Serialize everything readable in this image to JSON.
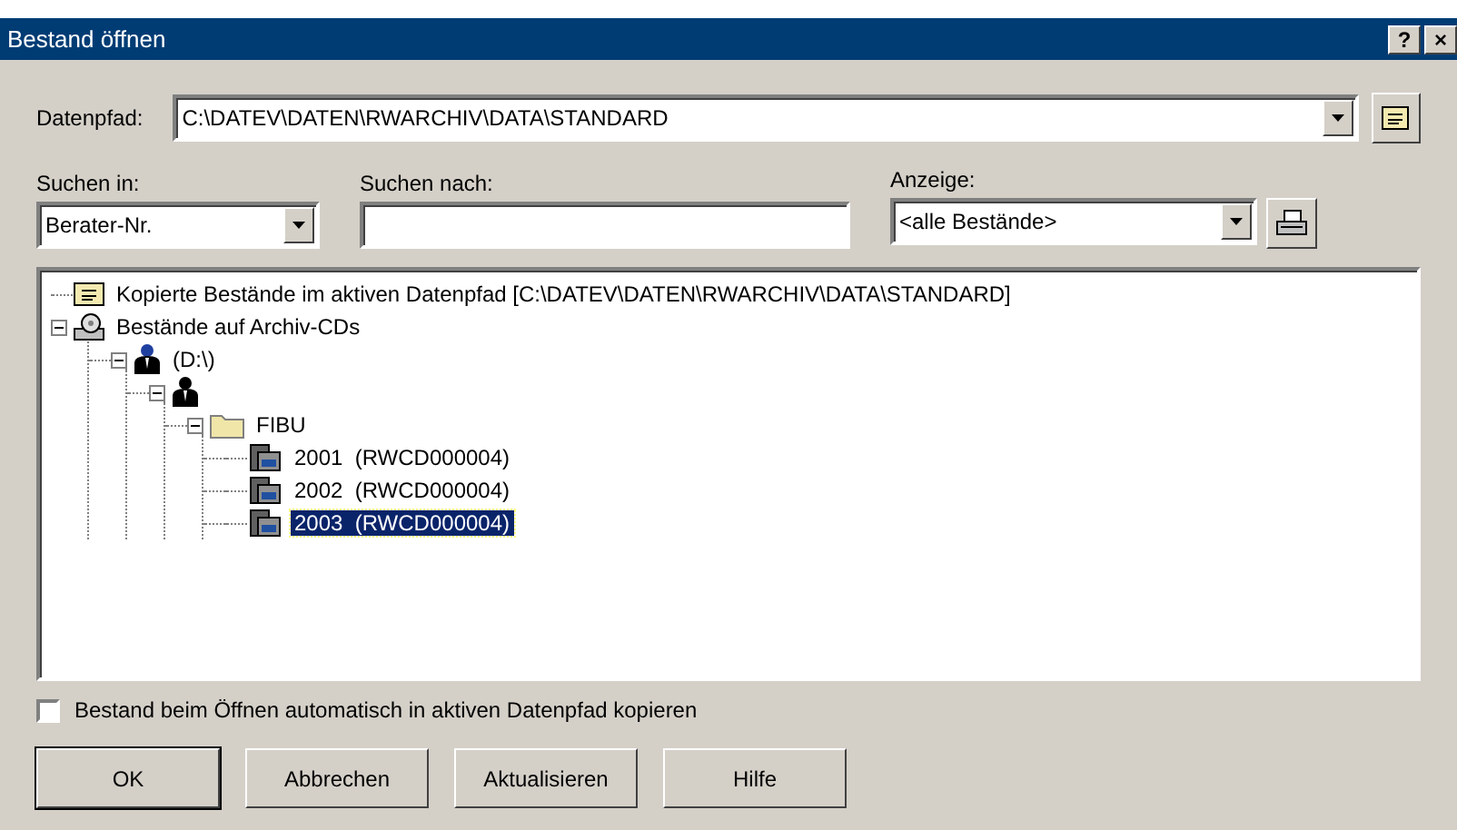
{
  "window": {
    "title": "Bestand öffnen",
    "title_buttons": [
      "?",
      "×"
    ]
  },
  "datenpfad": {
    "label": "Datenpfad:",
    "value": "C:\\DATEV\\DATEN\\RWARCHIV\\DATA\\STANDARD"
  },
  "suchen_in": {
    "label": "Suchen in:",
    "value": "Berater-Nr."
  },
  "suchen_nach": {
    "label": "Suchen nach:"
  },
  "anzeige": {
    "label": "Anzeige:",
    "value": "<alle Bestände>"
  },
  "tree": [
    {
      "kind": "copy",
      "label": "Kopierte Bestände im aktiven Datenpfad [C:\\DATEV\\DATEN\\RWARCHIV\\DATA\\STANDARD]",
      "selected": false
    },
    {
      "kind": "cd",
      "label": "Bestände auf Archiv-CDs",
      "selected": false,
      "expanded": true,
      "children": [
        {
          "kind": "person",
          "label": "(D:\\)",
          "selected": false,
          "expanded": true,
          "children": [
            {
              "kind": "advisor",
              "expanded": true,
              "children": [
                {
                  "kind": "folder",
                  "label": "FIBU",
                  "selected": false,
                  "expanded": true,
                  "children": [
                    {
                      "kind": "archive",
                      "label": "2001  (RWCD000004)",
                      "selected": false
                    },
                    {
                      "kind": "archive",
                      "label": "2002  (RWCD000004)",
                      "selected": false
                    },
                    {
                      "kind": "archive",
                      "label": "2003  (RWCD000004)",
                      "selected": true
                    }
                  ]
                }
              ]
            }
          ]
        }
      ]
    }
  ],
  "copy_option": {
    "label": "Bestand beim Öffnen automatisch in aktiven Datenpfad kopieren",
    "checked": false
  },
  "buttons": [
    {
      "label": "OK",
      "default": true
    },
    {
      "label": "Abbrechen",
      "default": false
    },
    {
      "label": "Aktualisieren",
      "default": false
    },
    {
      "label": "Hilfe",
      "default": false
    }
  ]
}
